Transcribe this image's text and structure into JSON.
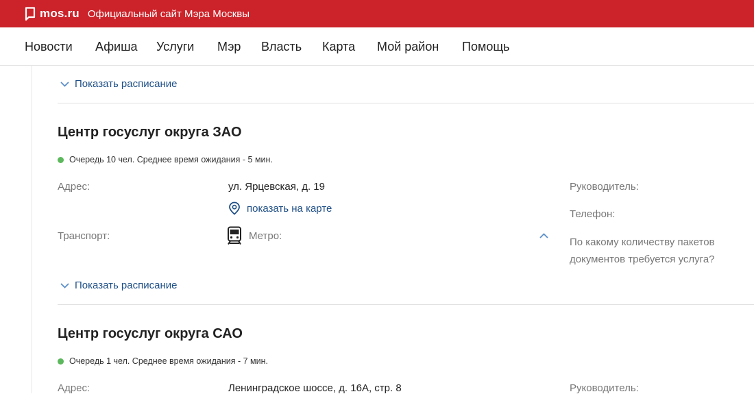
{
  "header": {
    "brand_name": "mos.ru",
    "tagline": "Официальный сайт Мэра Москвы",
    "accent_color": "#cc2229",
    "logo_icon": "speech-bubble-icon"
  },
  "nav": {
    "items": [
      "Новости",
      "Афиша",
      "Услуги",
      "Мэр",
      "Власть",
      "Карта",
      "Мой район",
      "Помощь"
    ]
  },
  "schedule_toggle_label": "Показать расписание",
  "centers": [
    {
      "title": "Центр госуслуг округа ЗАО",
      "queue": "Очередь 10 чел. Среднее время ожидания - 5 мин.",
      "address_label": "Адрес:",
      "address": "ул. Ярцевская, д. 19",
      "map_link": "показать на карте",
      "transport_label": "Транспорт:",
      "metro_label": "Метро:",
      "head_label": "Руководитель:",
      "phone_label": "Телефон:",
      "question": "По какому количеству пакетов документов требуется услуга?"
    },
    {
      "title": "Центр госуслуг округа САО",
      "queue": "Очередь 1 чел. Среднее время ожидания - 7 мин.",
      "address_label": "Адрес:",
      "address": "Ленинградское шоссе, д. 16А, стр. 8",
      "head_label": "Руководитель:"
    }
  ],
  "status_color": "#5cb85c",
  "link_color": "#1f4f86"
}
